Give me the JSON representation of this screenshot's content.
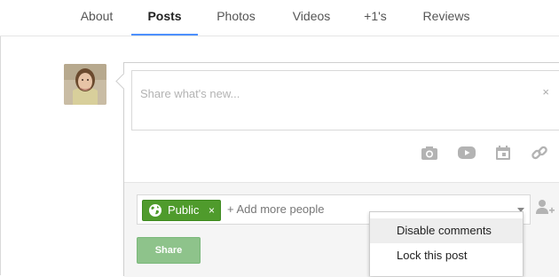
{
  "tabs": [
    {
      "label": "About",
      "active": false
    },
    {
      "label": "Posts",
      "active": true
    },
    {
      "label": "Photos",
      "active": false
    },
    {
      "label": "Videos",
      "active": false
    },
    {
      "label": "+1's",
      "active": false
    },
    {
      "label": "Reviews",
      "active": false
    }
  ],
  "composer": {
    "placeholder": "Share what's new...",
    "close_glyph": "×"
  },
  "media_icons": [
    "camera-icon",
    "video-icon",
    "calendar-icon",
    "link-icon"
  ],
  "audience": {
    "chip_label": "Public",
    "chip_remove_glyph": "×",
    "add_more_text": "+ Add more people"
  },
  "share_button": "Share",
  "menu": {
    "items": [
      "Disable comments",
      "Lock this post"
    ]
  },
  "colors": {
    "accent": "#4d90fe",
    "chip_green": "#4f9b2c",
    "share_button": "#8ec38b"
  }
}
